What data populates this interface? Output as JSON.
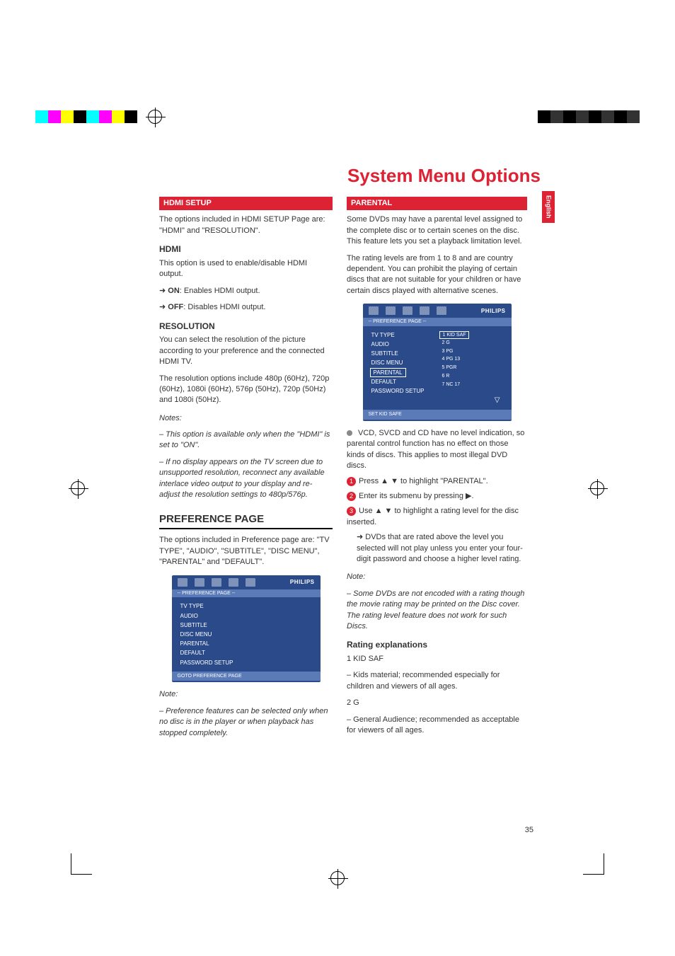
{
  "page_title": "System Menu Options",
  "side_tab": "English",
  "page_number": "35",
  "left": {
    "hdmi_setup_head": "HDMI SETUP",
    "hdmi_setup_intro": "The options included in HDMI SETUP Page are: \"HDMI\" and \"RESOLUTION\".",
    "hdmi_head": "HDMI",
    "hdmi_desc": "This option is used to enable/disable HDMI output.",
    "hdmi_on_label": "ON",
    "hdmi_on_text": ": Enables HDMI output.",
    "hdmi_off_label": "OFF",
    "hdmi_off_text": ": Disables HDMI output.",
    "res_head": "RESOLUTION",
    "res_p1": "You can select the resolution of the picture according to your preference and the connected HDMI TV.",
    "res_p2": "The resolution options include 480p (60Hz), 720p (60Hz), 1080i (60Hz), 576p (50Hz), 720p (50Hz) and 1080i (50Hz).",
    "notes_label": "Notes:",
    "note1": "– This option is available only when the \"HDMI\" is set to \"ON\".",
    "note2": "– If no display appears on the TV screen due to unsupported resolution, reconnect any available interlace video output to your display and re-adjust the resolution settings to 480p/576p.",
    "pref_head": "PREFERENCE PAGE",
    "pref_intro": "The options included in Preference page are: \"TV TYPE\", \"AUDIO\", \"SUBTITLE\", \"DISC MENU\", \"PARENTAL\" and \"DEFAULT\".",
    "pref_note_label": "Note:",
    "pref_note": "– Preference features can be selected only when no disc is in the player or when playback has stopped completely.",
    "menu1": {
      "title": "-- PREFERENCE PAGE --",
      "items": [
        "TV TYPE",
        "AUDIO",
        "SUBTITLE",
        "DISC MENU",
        "PARENTAL",
        "DEFAULT",
        "PASSWORD SETUP"
      ],
      "footer": "GOTO PREFERENCE PAGE",
      "brand": "PHILIPS"
    }
  },
  "right": {
    "parental_head": "PARENTAL",
    "parental_p1": "Some DVDs may have a parental level assigned to the complete disc or to certain scenes on the disc. This feature lets you set a playback limitation level.",
    "parental_p2": "The rating levels are from 1 to 8 and are country dependent. You can prohibit the playing of certain discs that are not suitable for your children or have certain discs played with alternative scenes.",
    "menu2": {
      "title": "-- PREFERENCE PAGE --",
      "items": [
        "TV TYPE",
        "AUDIO",
        "SUBTITLE",
        "DISC MENU",
        "PARENTAL",
        "DEFAULT",
        "PASSWORD SETUP"
      ],
      "ratings": [
        "1 KID SAF",
        "2 G",
        "3 PG",
        "4 PG 13",
        "5 PGR",
        "6 R",
        "7 NC 17"
      ],
      "footer": "SET KID SAFE",
      "brand": "PHILIPS"
    },
    "vcd_note": "VCD, SVCD and CD have no level indication, so parental control function has no effect on those kinds of discs. This applies to most illegal DVD discs.",
    "step1": "Press ▲ ▼ to highlight \"PARENTAL\".",
    "step2": "Enter its submenu by pressing ▶.",
    "step3": "Use ▲ ▼ to highlight a rating level for the disc inserted.",
    "step3b": "➜ DVDs that are rated above the level you selected will not play unless you enter your four-digit password and choose a higher level rating.",
    "note_label": "Note:",
    "note_text": "– Some DVDs are not encoded with a rating though the movie rating may be printed on the Disc cover. The rating level feature does not work for such Discs.",
    "rating_exp_head": "Rating explanations",
    "r1_head": "1 KID SAF",
    "r1_text": "– Kids material; recommended especially for children and viewers of all ages.",
    "r2_head": "2 G",
    "r2_text": "– General Audience; recommended as acceptable for viewers of all ages."
  }
}
